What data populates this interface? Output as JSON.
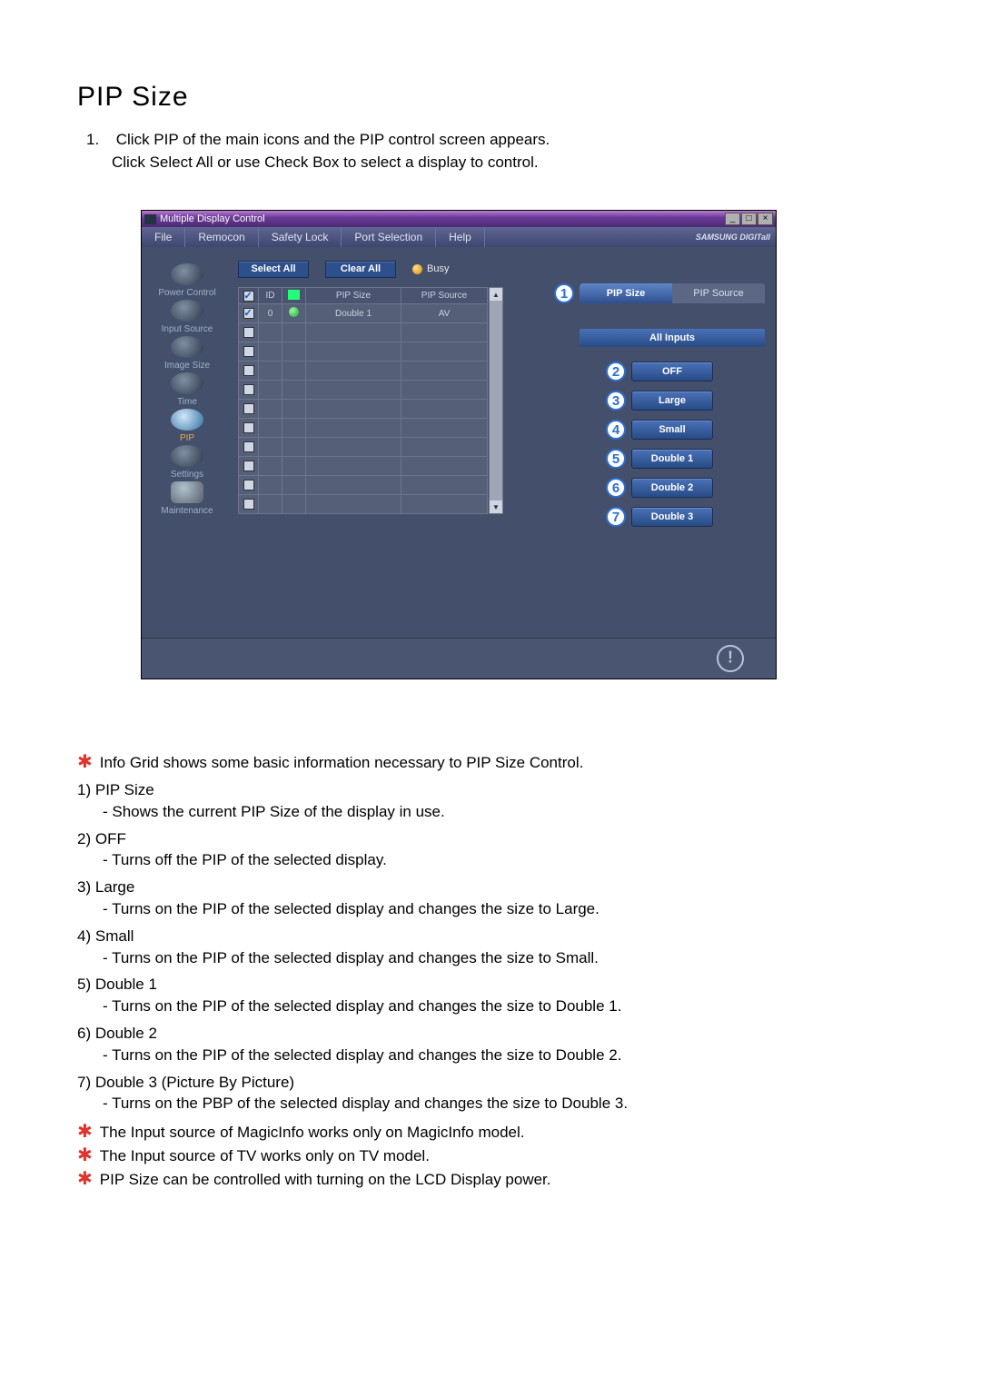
{
  "heading": "PIP Size",
  "intro": {
    "num": "1.",
    "line1": "Click PIP of the main icons and the PIP control screen appears.",
    "line2": "Click Select All or use Check Box to select a display to control."
  },
  "app": {
    "title": "Multiple Display Control",
    "menus": [
      "File",
      "Remocon",
      "Safety Lock",
      "Port Selection",
      "Help"
    ],
    "brand": "SAMSUNG DIGITall",
    "sidebar": [
      {
        "label": "Power Control"
      },
      {
        "label": "Input Source"
      },
      {
        "label": "Image Size"
      },
      {
        "label": "Time"
      },
      {
        "label": "PIP",
        "active": true
      },
      {
        "label": "Settings"
      },
      {
        "label": "Maintenance"
      }
    ],
    "buttons": {
      "select_all": "Select All",
      "clear_all": "Clear All",
      "busy": "Busy"
    },
    "grid": {
      "headers": {
        "id": "ID",
        "size": "PIP Size",
        "source": "PIP Source"
      },
      "rows": [
        {
          "checked": true,
          "id": "0",
          "status": "ok",
          "size": "Double 1",
          "source": "AV"
        },
        {
          "checked": false
        },
        {
          "checked": false
        },
        {
          "checked": false
        },
        {
          "checked": false
        },
        {
          "checked": false
        },
        {
          "checked": false
        },
        {
          "checked": false
        },
        {
          "checked": false
        },
        {
          "checked": false
        },
        {
          "checked": false
        }
      ]
    },
    "panel": {
      "tabs": {
        "size": "PIP Size",
        "source": "PIP Source"
      },
      "all_inputs": "All Inputs",
      "options": [
        "OFF",
        "Large",
        "Small",
        "Double 1",
        "Double 2",
        "Double 3"
      ]
    }
  },
  "info_grid_note": "Info Grid shows some basic information necessary to PIP Size Control.",
  "descriptions": [
    {
      "n": "1)",
      "title": "PIP Size",
      "sub": "- Shows the current PIP Size of the display in use."
    },
    {
      "n": "2)",
      "title": "OFF",
      "sub": "- Turns off the PIP of the selected display."
    },
    {
      "n": "3)",
      "title": "Large",
      "sub": "- Turns on the PIP of the selected display and changes the size to Large."
    },
    {
      "n": "4)",
      "title": "Small",
      "sub": "- Turns on the PIP of the selected display and changes the size to Small."
    },
    {
      "n": "5)",
      "title": "Double 1",
      "sub": "- Turns on the PIP of the selected display and changes the size to Double 1."
    },
    {
      "n": "6)",
      "title": "Double 2",
      "sub": "- Turns on the PIP of the selected display and changes the size to Double 2."
    },
    {
      "n": "7)",
      "title": "Double 3 (Picture By Picture)",
      "sub": "- Turns on the PBP of the selected display and changes the size to Double 3."
    }
  ],
  "notes": [
    "The Input source of MagicInfo works only on MagicInfo model.",
    "The Input source of TV works only on TV model.",
    "PIP Size can be controlled with turning on the LCD Display power."
  ]
}
